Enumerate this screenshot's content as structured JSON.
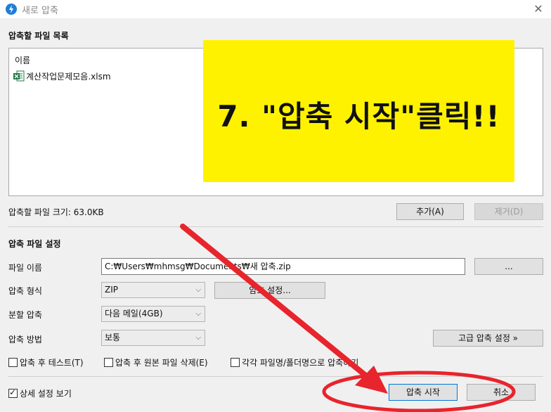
{
  "window": {
    "title": "새로 압축",
    "close_glyph": "✕"
  },
  "file_list": {
    "section_title": "압축할 파일 목록",
    "column_header": "이름",
    "files": [
      {
        "name": "계산작업문제모음.xlsm",
        "icon": "excel-file-icon"
      }
    ],
    "size_label": "압축할 파일 크기: 63.0KB"
  },
  "buttons": {
    "add": "추가(A)",
    "remove": "제거(D)",
    "browse": "...",
    "password": "암호 설정...",
    "advanced": "고급 압축 설정 »",
    "start": "압축 시작",
    "cancel": "취소"
  },
  "settings": {
    "section_title": "압축 파일 설정",
    "filename_label": "파일 이름",
    "filename_value": "C:₩Users₩mhmsg₩Documents₩새 압축.zip",
    "format_label": "압축 형식",
    "format_value": "ZIP",
    "split_label": "분할 압축",
    "split_value": "다음 메일(4GB)",
    "method_label": "압축 방법",
    "method_value": "보통"
  },
  "options": {
    "test_after": "압축 후 테스트(T)",
    "delete_original": "압축 후 원본 파일 삭제(E)",
    "compress_each": "각각 파일명/폴더명으로 압축하기",
    "show_details": "상세 설정 보기"
  },
  "annotation": {
    "callout_text": "7. \"압축 시작\"클릭!!",
    "callout_color": "#fff200",
    "arrow_color": "#e8242c"
  },
  "colors": {
    "accent": "#0078d7",
    "background": "#f0f0f0"
  }
}
